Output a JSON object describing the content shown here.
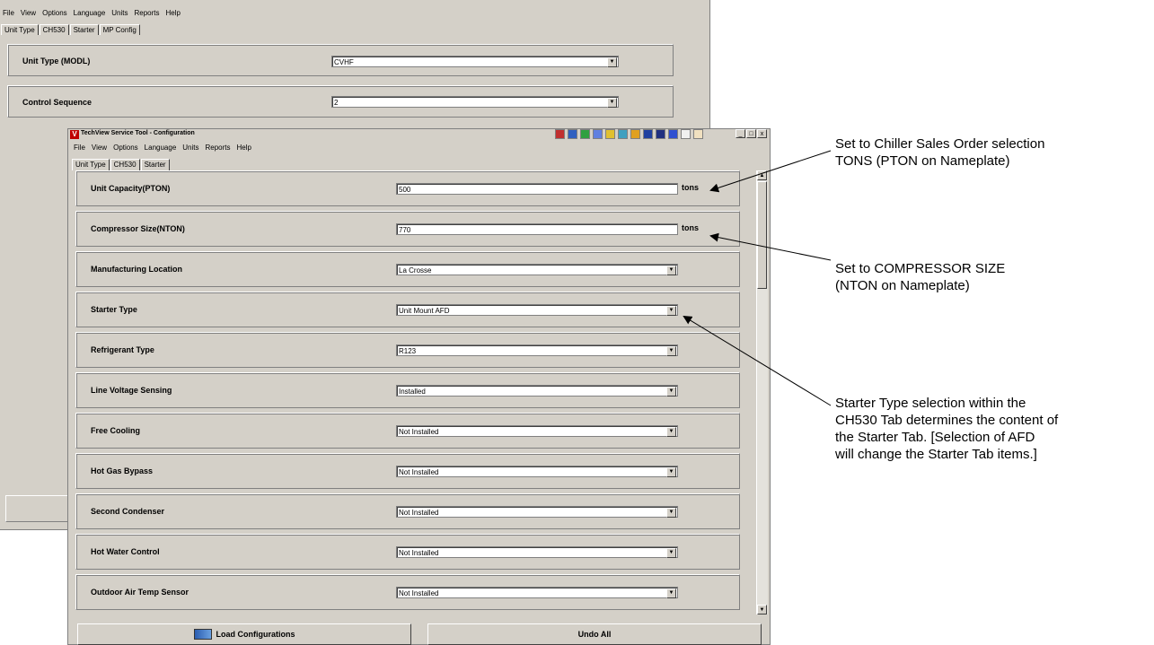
{
  "background_window": {
    "menu": [
      "File",
      "View",
      "Options",
      "Language",
      "Units",
      "Reports",
      "Help"
    ],
    "tabs": [
      "Unit Type",
      "CH530",
      "Starter",
      "MP Config"
    ],
    "rows": [
      {
        "label": "Unit Type (MODL)",
        "value": "CVHF"
      },
      {
        "label": "Control Sequence",
        "value": "2"
      }
    ]
  },
  "foreground_window": {
    "title": "TechView Service Tool - Configuration",
    "menu": [
      "File",
      "View",
      "Options",
      "Language",
      "Units",
      "Reports",
      "Help"
    ],
    "tabs": [
      "Unit Type",
      "CH530",
      "Starter"
    ],
    "rows": [
      {
        "label": "Unit Capacity(PTON)",
        "value": "500",
        "unit": "tons"
      },
      {
        "label": "Compressor Size(NTON)",
        "value": "770",
        "unit": "tons"
      },
      {
        "label": "Manufacturing Location",
        "value": "La Crosse"
      },
      {
        "label": "Starter Type",
        "value": "Unit Mount AFD"
      },
      {
        "label": "Refrigerant Type",
        "value": "R123"
      },
      {
        "label": "Line Voltage Sensing",
        "value": "Installed"
      },
      {
        "label": "Free Cooling",
        "value": "Not Installed"
      },
      {
        "label": "Hot Gas Bypass",
        "value": "Not Installed"
      },
      {
        "label": "Second Condenser",
        "value": "Not Installed"
      },
      {
        "label": "Hot Water Control",
        "value": "Not Installed"
      },
      {
        "label": "Outdoor Air Temp Sensor",
        "value": "Not Installed"
      }
    ],
    "buttons": {
      "load": "Load Configurations",
      "undo": "Undo All"
    },
    "window_controls": {
      "minimize": "_",
      "maximize": "□",
      "close": "x"
    }
  },
  "annotations": {
    "note1": [
      "Set to Chiller Sales Order selection",
      "TONS (PTON on Nameplate)"
    ],
    "note2": [
      "Set to COMPRESSOR SIZE",
      "(NTON on Nameplate)"
    ],
    "note3": [
      "Starter Type selection within the",
      "CH530 Tab determines the content of",
      "the Starter Tab. [Selection of AFD",
      "will change the Starter Tab items.]"
    ]
  }
}
